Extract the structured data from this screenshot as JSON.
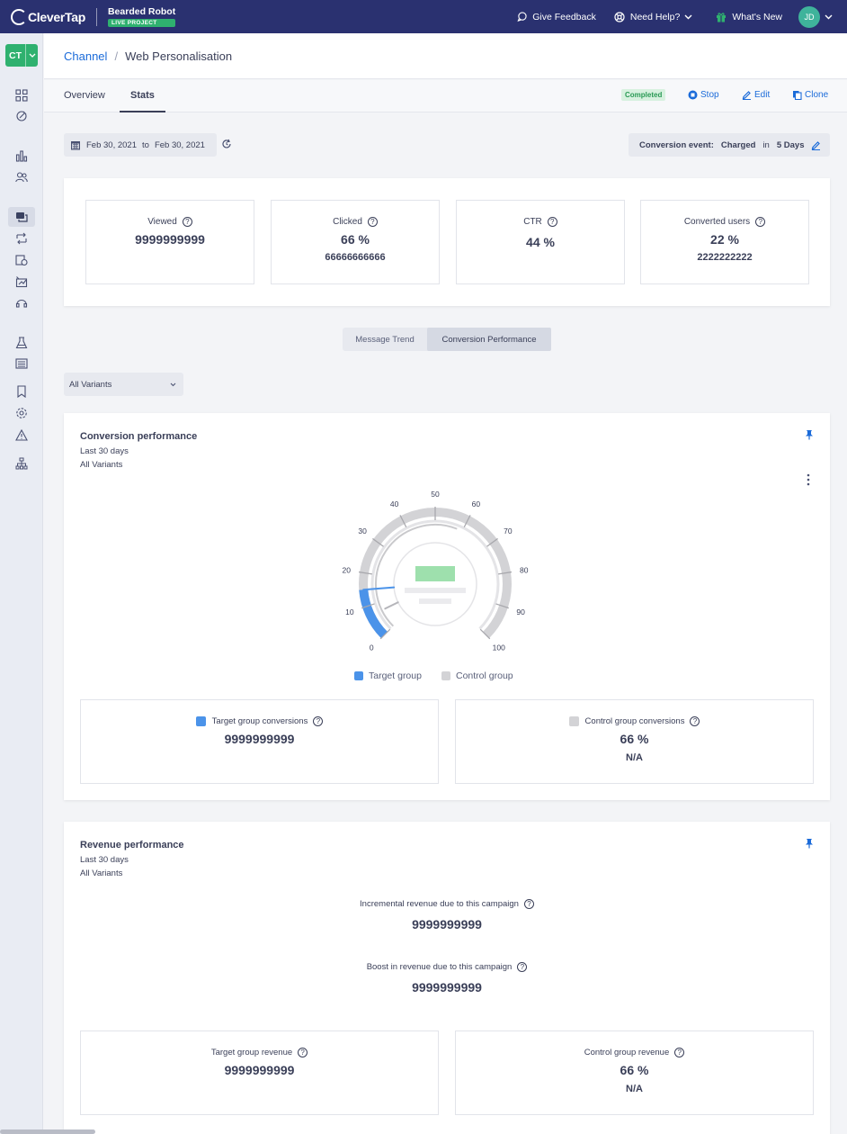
{
  "topbar": {
    "logo": "CleverTap",
    "project_name": "Bearded Robot",
    "project_badge": "LIVE PROJECT",
    "give_feedback": "Give Feedback",
    "need_help": "Need Help?",
    "whats_new": "What's New",
    "avatar_initials": "JD"
  },
  "sidebar": {
    "account_badge": "CT",
    "icons": [
      "grid-icon",
      "integration-icon",
      "analytics-icon",
      "segments-icon",
      "messages-icon",
      "journeys-icon",
      "campaigns-icon",
      "experiments-icon",
      "support-icon",
      "lab-icon",
      "catalog-icon",
      "bookmark-icon",
      "settings-icon",
      "alerts-icon",
      "hierarchy-icon"
    ]
  },
  "breadcrumb": {
    "parent": "Channel",
    "separator": "/",
    "current": "Web Personalisation"
  },
  "tabs": {
    "overview": "Overview",
    "stats": "Stats"
  },
  "status": "Completed",
  "actions": {
    "stop": "Stop",
    "edit": "Edit",
    "clone": "Clone"
  },
  "date_range": {
    "from": "Feb 30, 2021",
    "to_label": "to",
    "to": "Feb 30, 2021"
  },
  "conversion_event": {
    "label": "Conversion event:",
    "event": "Charged",
    "in_label": "in",
    "window": "5 Days"
  },
  "stats": [
    {
      "label": "Viewed",
      "value": "9999999999",
      "sub": ""
    },
    {
      "label": "Clicked",
      "value": "66 %",
      "sub": "66666666666"
    },
    {
      "label": "CTR",
      "value": "44 %",
      "sub": ""
    },
    {
      "label": "Converted users",
      "value": "22 %",
      "sub": "2222222222"
    }
  ],
  "view_toggle": {
    "message_trend": "Message Trend",
    "conversion_performance": "Conversion Performance"
  },
  "variant_select": {
    "value": "All Variants"
  },
  "conversion_card": {
    "title": "Conversion performance",
    "period": "Last 30 days",
    "variants": "All Variants",
    "gauge": {
      "ticks": [
        "0",
        "10",
        "20",
        "30",
        "40",
        "50",
        "60",
        "70",
        "80",
        "90",
        "100"
      ],
      "target_fraction": 0.15,
      "colors": {
        "target": "#4b93e9",
        "control": "#d3d3d6",
        "placeholder": "#9ee0ad"
      }
    },
    "legend": {
      "target": "Target group",
      "control": "Control group"
    },
    "target_box": {
      "label": "Target group conversions",
      "value": "9999999999"
    },
    "control_box": {
      "label": "Control group conversions",
      "value": "66 %",
      "sub": "N/A"
    }
  },
  "revenue_card": {
    "title": "Revenue performance",
    "period": "Last 30 days",
    "variants": "All Variants",
    "incremental_label": "Incremental revenue due to this campaign",
    "incremental_value": "9999999999",
    "boost_label": "Boost in revenue due to this campaign",
    "boost_value": "9999999999",
    "target_box": {
      "label": "Target group revenue",
      "value": "9999999999"
    },
    "control_box": {
      "label": "Control group revenue",
      "value": "66 %",
      "sub": "N/A"
    }
  },
  "colors": {
    "brand_navy": "#2a3170",
    "accent_blue": "#1b6bd9",
    "green": "#2fb16f"
  }
}
